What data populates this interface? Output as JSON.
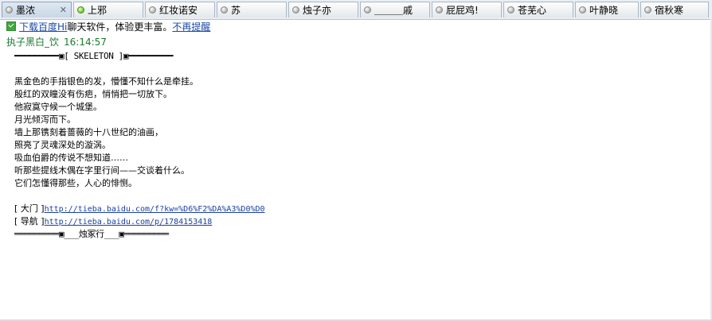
{
  "tabs": [
    {
      "label": "墨浓",
      "status": "offline",
      "active": true,
      "closable": true
    },
    {
      "label": "上邪",
      "status": "online",
      "active": false
    },
    {
      "label": "红妆诺安",
      "status": "offline",
      "active": false
    },
    {
      "label": "苏",
      "status": "offline",
      "active": false
    },
    {
      "label": "烛子亦",
      "status": "offline",
      "active": false
    },
    {
      "label": "＿＿＿戚",
      "status": "offline",
      "active": false
    },
    {
      "label": "屁屁鸡!",
      "status": "offline",
      "active": false
    },
    {
      "label": "苍芜心",
      "status": "offline",
      "active": false
    },
    {
      "label": "叶静晓",
      "status": "offline",
      "active": false
    },
    {
      "label": "宿秋寒",
      "status": "offline",
      "active": false
    }
  ],
  "notice": {
    "download_link": "下载百度Hi",
    "text": "聊天软件，体验更丰富。",
    "dismiss_link": "不再提醒"
  },
  "message": {
    "sender": "执子黑白_饮",
    "time": "16:14:57",
    "header_rule": "━━━━━━━━━▣[ SKELETON ]▣━━━━━━━━━",
    "poem": [
      "黑金色的手指银色的发，懵懂不知什么是牵挂。",
      "殷红的双瞳没有伤疤，悄悄把一切放下。",
      "他寂寞守候一个城堡。",
      "月光倾泻而下。",
      "墙上那镌刻着蔷薇的十八世纪的油画，",
      "照亮了灵魂深处的漩涡。",
      "吸血伯爵的传说不想知道……",
      "听那些提线木偶在字里行间——交谈着什么。",
      "它们怎懂得那些，人心的悱恻。"
    ],
    "links": [
      {
        "label": "[ 大门 ]",
        "url": "http://tieba.baidu.com/f?kw=%D6%F2%DA%A3%D0%D0"
      },
      {
        "label": "[ 导航 ]",
        "url": "http://tieba.baidu.com/p/1784153418"
      }
    ],
    "footer_rule": "═════════▣___烛冢行___▣═════════"
  }
}
